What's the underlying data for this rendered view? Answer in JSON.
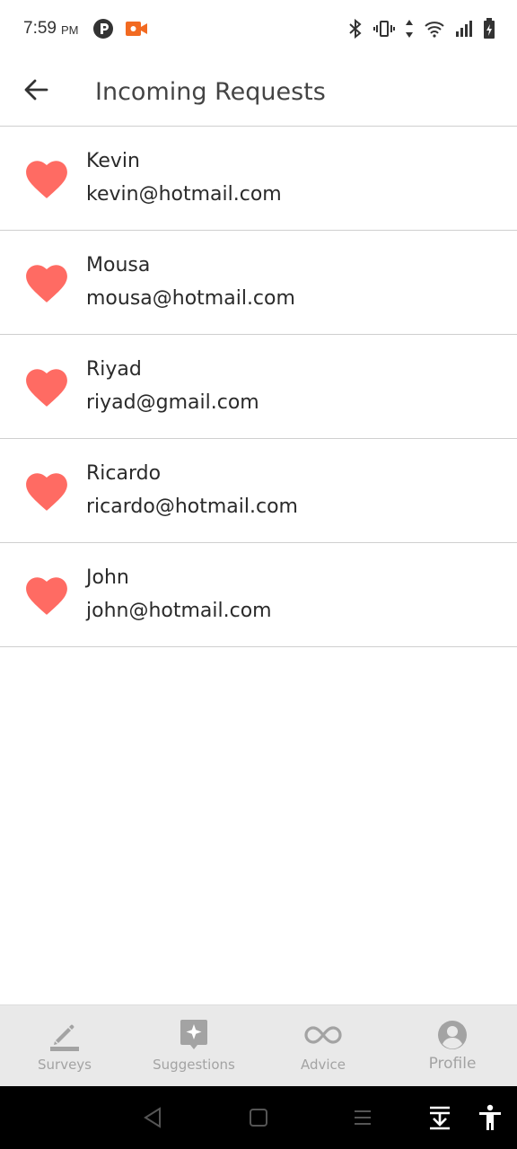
{
  "status_bar": {
    "time": "7:59",
    "ampm": "PM",
    "icons": [
      "privacy-p-icon",
      "video-record-icon",
      "bluetooth-icon",
      "vibrate-icon",
      "data-arrows-icon",
      "wifi-icon",
      "signal-icon",
      "battery-charging-icon"
    ]
  },
  "app_bar": {
    "back_icon": "arrow-left-icon",
    "title": "Incoming Requests"
  },
  "requests": [
    {
      "name": "Kevin",
      "email": "kevin@hotmail.com"
    },
    {
      "name": "Mousa",
      "email": "mousa@hotmail.com"
    },
    {
      "name": "Riyad",
      "email": "riyad@gmail.com"
    },
    {
      "name": "Ricardo",
      "email": "ricardo@hotmail.com"
    },
    {
      "name": "John",
      "email": "john@hotmail.com"
    }
  ],
  "bottom_nav": {
    "items": [
      {
        "label": "Surveys",
        "icon": "pencil-icon"
      },
      {
        "label": "Suggestions",
        "icon": "sparkle-badge-icon"
      },
      {
        "label": "Advice",
        "icon": "infinity-icon"
      },
      {
        "label": "Profile",
        "icon": "user-circle-icon"
      }
    ]
  },
  "system_nav": {
    "icons": [
      "back-triangle-icon",
      "home-square-icon",
      "recents-lines-icon",
      "download-dock-icon",
      "accessibility-icon"
    ]
  },
  "colors": {
    "heart": "#ff6b63",
    "nav_background": "#e9e9e9",
    "nav_inactive": "#a3a3a3",
    "divider": "#cfcfcf",
    "record_icon": "#f26a21"
  }
}
